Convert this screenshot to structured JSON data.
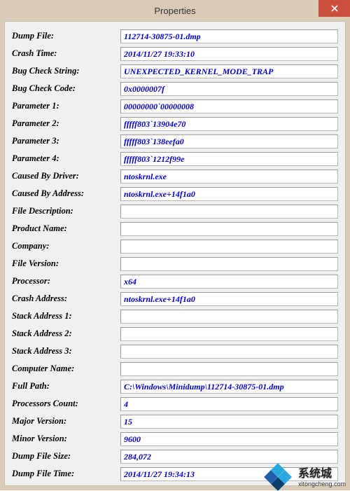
{
  "window": {
    "title": "Properties"
  },
  "fields": [
    {
      "label": "Dump File:",
      "value": "112714-30875-01.dmp"
    },
    {
      "label": "Crash Time:",
      "value": "2014/11/27 19:33:10"
    },
    {
      "label": "Bug Check String:",
      "value": "UNEXPECTED_KERNEL_MODE_TRAP"
    },
    {
      "label": "Bug Check Code:",
      "value": "0x0000007f"
    },
    {
      "label": "Parameter 1:",
      "value": "00000000`00000008"
    },
    {
      "label": "Parameter 2:",
      "value": "fffff803`13904e70"
    },
    {
      "label": "Parameter 3:",
      "value": "fffff803`138eefa0"
    },
    {
      "label": "Parameter 4:",
      "value": "fffff803`1212f99e"
    },
    {
      "label": "Caused By Driver:",
      "value": "ntoskrnl.exe"
    },
    {
      "label": "Caused By Address:",
      "value": "ntoskrnl.exe+14f1a0"
    },
    {
      "label": "File Description:",
      "value": ""
    },
    {
      "label": "Product Name:",
      "value": ""
    },
    {
      "label": "Company:",
      "value": ""
    },
    {
      "label": "File Version:",
      "value": ""
    },
    {
      "label": "Processor:",
      "value": "x64"
    },
    {
      "label": "Crash Address:",
      "value": "ntoskrnl.exe+14f1a0"
    },
    {
      "label": "Stack Address 1:",
      "value": ""
    },
    {
      "label": "Stack Address 2:",
      "value": ""
    },
    {
      "label": "Stack Address 3:",
      "value": ""
    },
    {
      "label": "Computer Name:",
      "value": ""
    },
    {
      "label": "Full Path:",
      "value": "C:\\Windows\\Minidump\\112714-30875-01.dmp"
    },
    {
      "label": "Processors Count:",
      "value": "4"
    },
    {
      "label": "Major Version:",
      "value": "15"
    },
    {
      "label": "Minor Version:",
      "value": "9600"
    },
    {
      "label": "Dump File Size:",
      "value": "284,072"
    },
    {
      "label": "Dump File Time:",
      "value": "2014/11/27 19:34:13"
    }
  ],
  "watermark": {
    "text": "系统城",
    "sub": "xitongcheng.com"
  }
}
